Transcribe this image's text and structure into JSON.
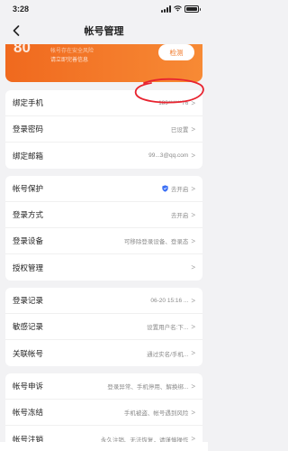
{
  "status": {
    "time": "3:28"
  },
  "nav": {
    "title": "帐号管理"
  },
  "banner": {
    "score": "80",
    "line1": "帐号存在安全风险",
    "line2": "请立即完善信息",
    "button": "检测"
  },
  "group1": [
    {
      "label": "绑定手机",
      "value": "189******76"
    },
    {
      "label": "登录密码",
      "value": "已设置"
    },
    {
      "label": "绑定邮箱",
      "value": "99...3@qq.com"
    }
  ],
  "group2": [
    {
      "label": "帐号保护",
      "value": "去开启"
    },
    {
      "label": "登录方式",
      "value": "去开启"
    },
    {
      "label": "登录设备",
      "value": "可移除登录设备、登录态"
    },
    {
      "label": "授权管理",
      "value": ""
    }
  ],
  "group3": [
    {
      "label": "登录记录",
      "value": "06-20 15:16 ..."
    },
    {
      "label": "敏感记录",
      "value": "设置用户名:下..."
    },
    {
      "label": "关联帐号",
      "value": "通过实名/手机..."
    }
  ],
  "group4": [
    {
      "label": "帐号申诉",
      "value": "登录异常、手机停用、解换绑..."
    },
    {
      "label": "帐号冻结",
      "value": "手机被盗、帐号遇到风险"
    },
    {
      "label": "帐号注销",
      "value": "永久注销、无法恢复，请谨慎操作"
    }
  ],
  "colors": {
    "accent": "#f07422",
    "annotation": "#e8232f",
    "shield": "#3b6ff5"
  },
  "icons": {
    "back": "back-arrow-icon",
    "chevron": "chevron-right-icon",
    "shield": "shield-icon"
  }
}
